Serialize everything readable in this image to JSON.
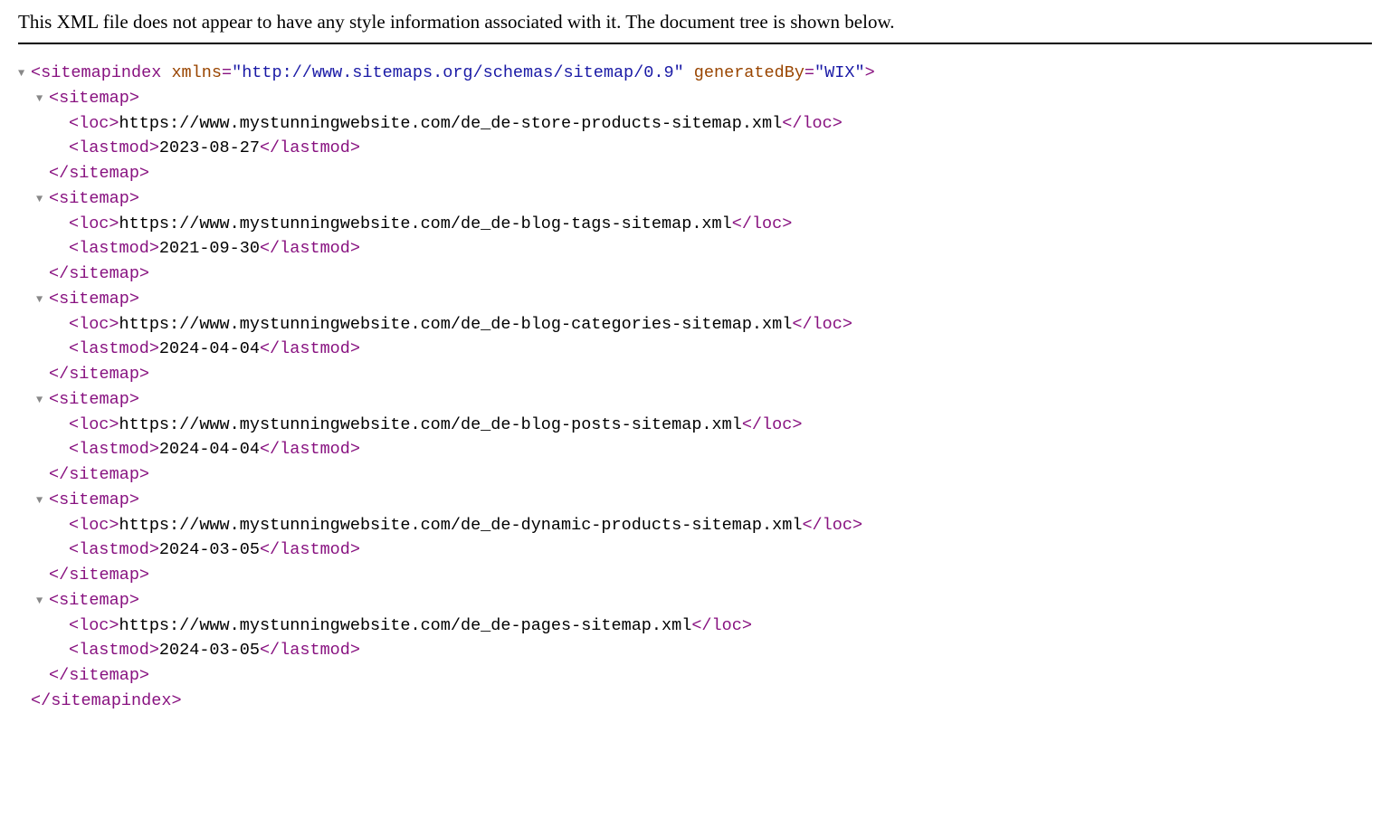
{
  "notice": "This XML file does not appear to have any style information associated with it. The document tree is shown below.",
  "root": {
    "tagName": "sitemapindex",
    "attrs": [
      {
        "name": "xmlns",
        "value": "http://www.sitemaps.org/schemas/sitemap/0.9"
      },
      {
        "name": "generatedBy",
        "value": "WIX"
      }
    ],
    "childTag": "sitemap",
    "locTag": "loc",
    "lastmodTag": "lastmod"
  },
  "sitemaps": [
    {
      "loc": "https://www.mystunningwebsite.com/de_de-store-products-sitemap.xml",
      "lastmod": "2023-08-27"
    },
    {
      "loc": "https://www.mystunningwebsite.com/de_de-blog-tags-sitemap.xml",
      "lastmod": "2021-09-30"
    },
    {
      "loc": "https://www.mystunningwebsite.com/de_de-blog-categories-sitemap.xml",
      "lastmod": "2024-04-04"
    },
    {
      "loc": "https://www.mystunningwebsite.com/de_de-blog-posts-sitemap.xml",
      "lastmod": "2024-04-04"
    },
    {
      "loc": "https://www.mystunningwebsite.com/de_de-dynamic-products-sitemap.xml",
      "lastmod": "2024-03-05"
    },
    {
      "loc": "https://www.mystunningwebsite.com/de_de-pages-sitemap.xml",
      "lastmod": "2024-03-05"
    }
  ]
}
